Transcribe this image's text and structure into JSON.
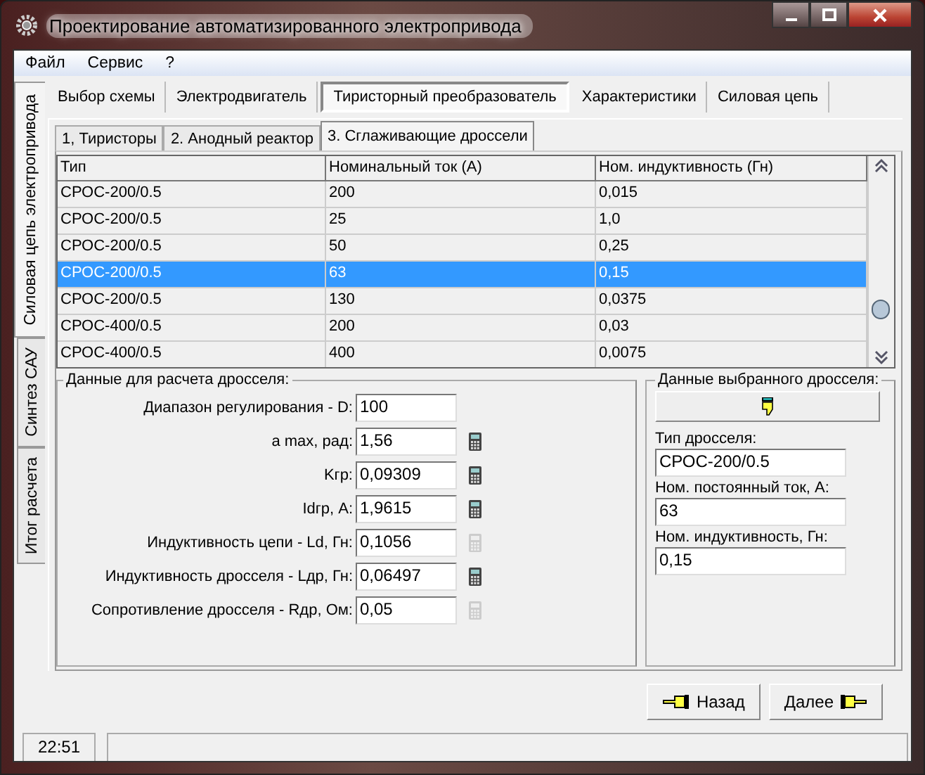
{
  "window": {
    "title": "Проектирование автоматизированного электропривода"
  },
  "menu": [
    "Файл",
    "Сервис",
    "?"
  ],
  "side_tabs": [
    {
      "label": "Силовая цепь электропривода",
      "selected": true
    },
    {
      "label": "Синтез САУ",
      "selected": false
    },
    {
      "label": "Итог расчета",
      "selected": false
    }
  ],
  "tabs": [
    {
      "label": "Выбор схемы",
      "selected": false
    },
    {
      "label": "Электродвигатель",
      "selected": false
    },
    {
      "label": "Тиристорный преобразователь",
      "selected": true
    },
    {
      "label": "Характеристики",
      "selected": false
    },
    {
      "label": "Силовая цепь",
      "selected": false
    }
  ],
  "subtabs": [
    {
      "label": "1, Тиристоры",
      "selected": false
    },
    {
      "label": "2. Анодный реактор",
      "selected": false
    },
    {
      "label": "3. Сглаживающие дроссели",
      "selected": true
    }
  ],
  "table": {
    "columns": [
      "Тип",
      "Номинальный ток (A)",
      "Ном. индуктивность (Гн)"
    ],
    "rows": [
      {
        "cells": [
          "СРОС-200/0.5",
          "200",
          "0,015"
        ],
        "selected": false
      },
      {
        "cells": [
          "СРОС-200/0.5",
          "25",
          "1,0"
        ],
        "selected": false
      },
      {
        "cells": [
          "СРОС-200/0.5",
          "50",
          "0,25"
        ],
        "selected": false
      },
      {
        "cells": [
          "СРОС-200/0.5",
          "63",
          "0,15"
        ],
        "selected": true
      },
      {
        "cells": [
          "СРОС-200/0.5",
          "130",
          "0,0375"
        ],
        "selected": false
      },
      {
        "cells": [
          "СРОС-400/0.5",
          "200",
          "0,03"
        ],
        "selected": false
      },
      {
        "cells": [
          "СРОС-400/0.5",
          "400",
          "0,0075"
        ],
        "selected": false
      }
    ]
  },
  "calc_group": {
    "title": "Данные для расчета дросселя:",
    "fields": [
      {
        "label": "Диапазон регулирования - D:",
        "value": "100"
      },
      {
        "label": "a max, рад:",
        "value": "1,56",
        "calc_enabled": true
      },
      {
        "label": "Kгр:",
        "value": "0,09309",
        "calc_enabled": true
      },
      {
        "label": "Idгр, A:",
        "value": "1,9615",
        "calc_enabled": true
      },
      {
        "label": "Индуктивность цепи - Ld, Гн:",
        "value": "0,1056",
        "calc_enabled": false
      },
      {
        "label": "Индуктивность дросселя - Lдр, Гн:",
        "value": "0,06497",
        "calc_enabled": true
      },
      {
        "label": "Сопротивление дросселя - Rдр, Ом:",
        "value": "0,05",
        "calc_enabled": false
      }
    ]
  },
  "selected_group": {
    "title": "Данные выбранного дросселя:",
    "fields": [
      {
        "label": "Тип дросселя:",
        "value": "СРОС-200/0.5"
      },
      {
        "label": "Ном. постоянный ток, A:",
        "value": "63"
      },
      {
        "label": "Ном. индуктивность, Гн:",
        "value": "0,15"
      }
    ]
  },
  "buttons": [
    {
      "label": "Назад",
      "kind": "back"
    },
    {
      "label": "Далее",
      "kind": "next"
    }
  ],
  "status_bar": {
    "time": "22:51"
  }
}
